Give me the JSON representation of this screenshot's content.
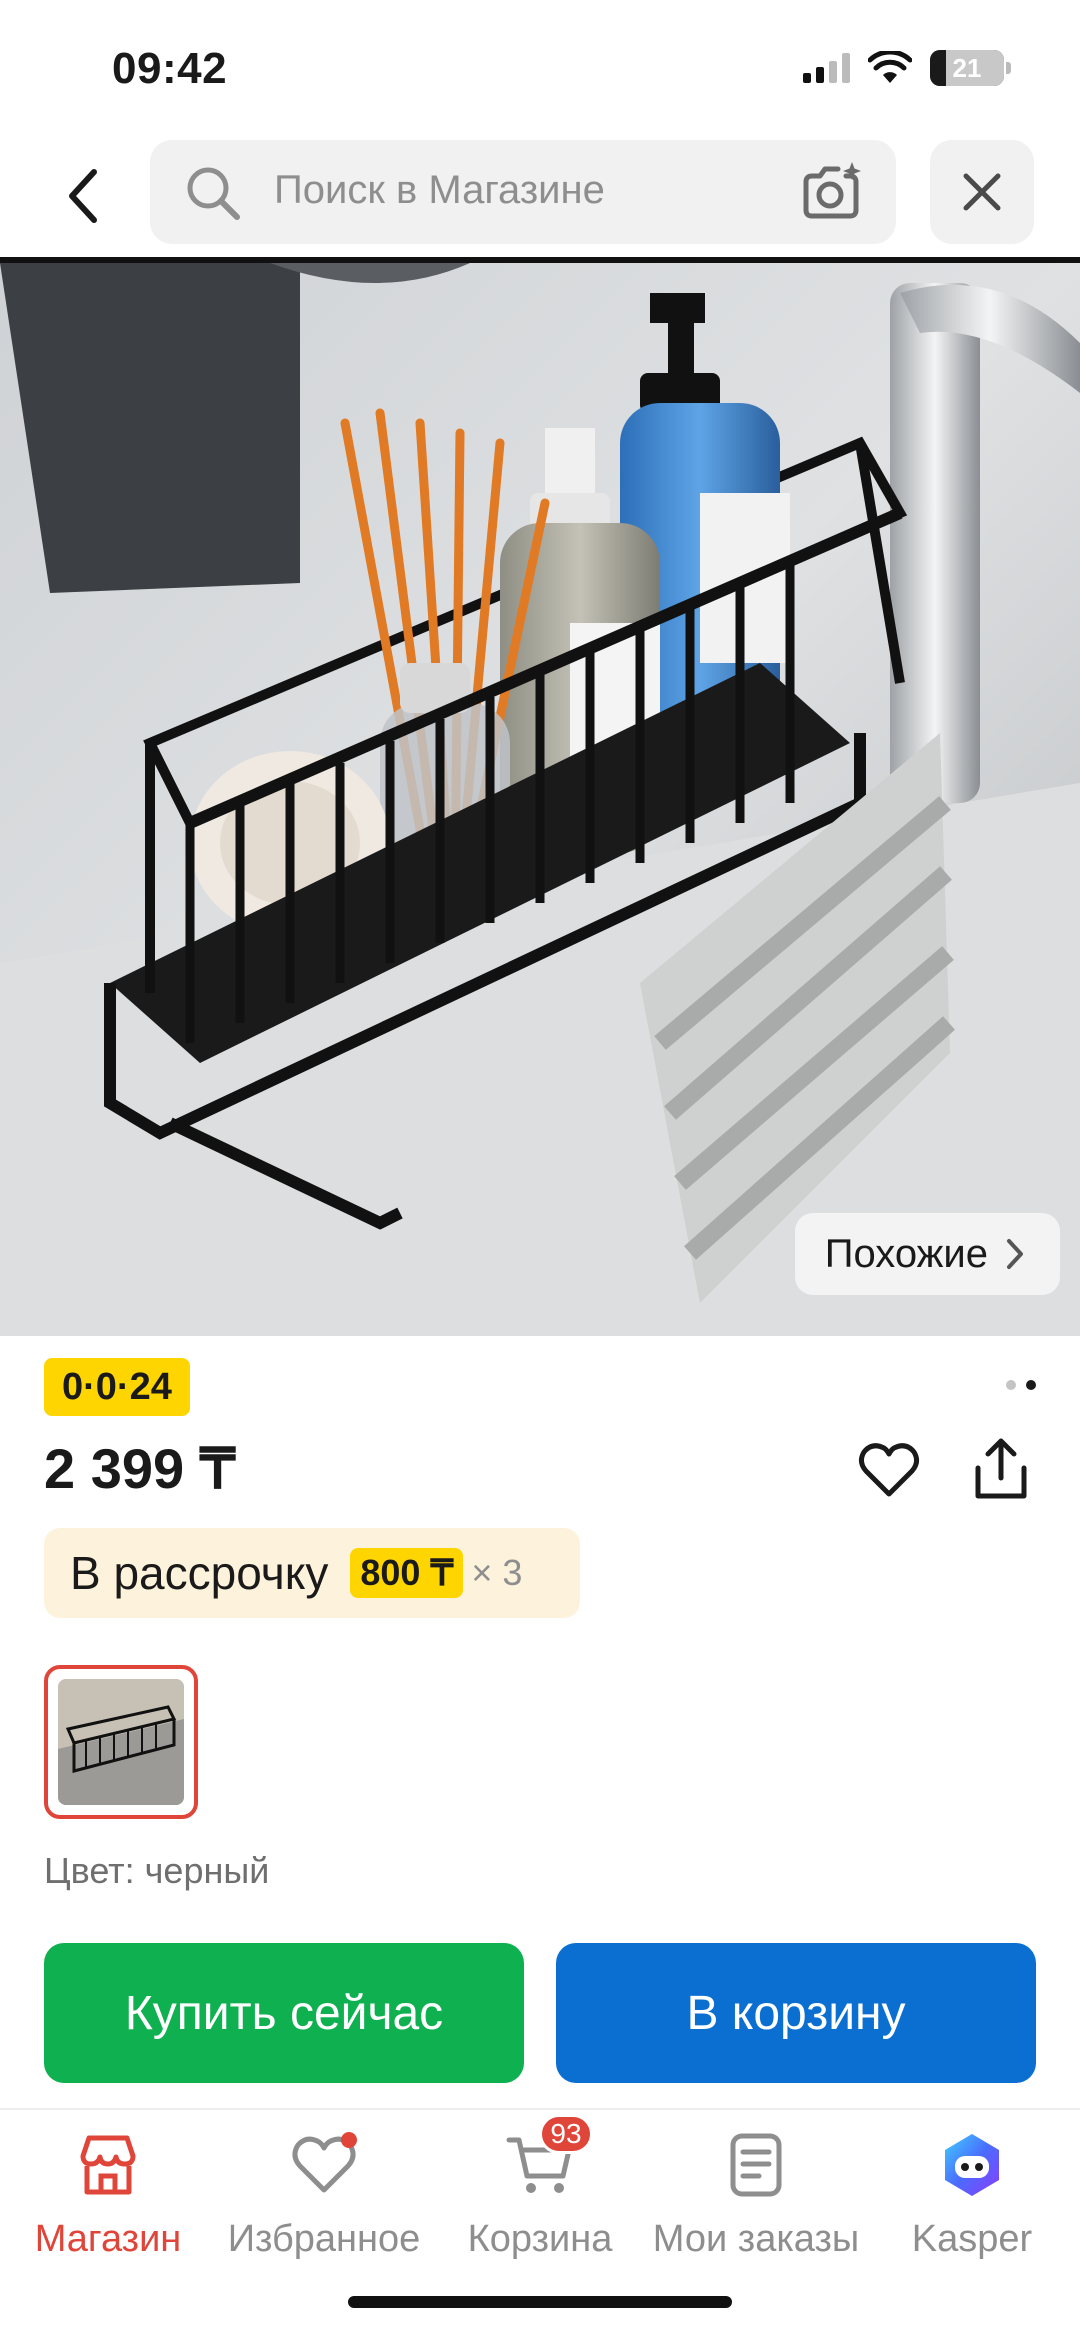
{
  "status_bar": {
    "time": "09:42",
    "battery": "21",
    "battery_level": 0.21
  },
  "search": {
    "placeholder": "Поиск в Магазине"
  },
  "product": {
    "similar_label": "Похожие",
    "badge": "0·0·24",
    "price": "2 399 ₸",
    "installment": {
      "label": "В рассрочку",
      "amount": "800 ₸",
      "times": "× 3"
    },
    "color_label": "Цвет: черный",
    "image_pager": {
      "total": 2,
      "active": 2
    }
  },
  "actions": {
    "buy_now": "Купить сейчас",
    "add_to_cart": "В корзину"
  },
  "nav": {
    "items": [
      {
        "label": "Магазин",
        "icon": "store-icon",
        "active": true
      },
      {
        "label": "Избранное",
        "icon": "heart-icon"
      },
      {
        "label": "Корзина",
        "icon": "cart-icon",
        "badge": "93"
      },
      {
        "label": "Мои заказы",
        "icon": "orders-icon"
      },
      {
        "label": "Kasper",
        "icon": "kasper-assistant-icon"
      }
    ]
  },
  "colors": {
    "accent_red": "#e0453a",
    "buy_green": "#0fb050",
    "cart_blue": "#0a6fd1",
    "badge_yellow": "#ffd500"
  }
}
